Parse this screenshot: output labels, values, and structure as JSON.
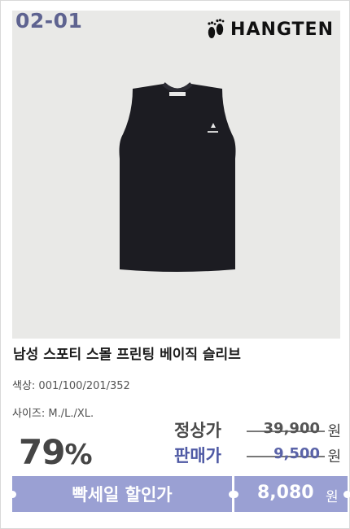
{
  "product": {
    "code": "02-01",
    "brand": "HANGTEN",
    "title": "남성 스포티 스몰 프린팅 베이직 슬리브",
    "colors_label": "색상",
    "colors_value": ": 001/100/201/352",
    "sizes_label": "사이즈",
    "sizes_value": ": M./L./XL.",
    "colors": {
      "accent": "#9aa0d3",
      "code_text": "#5e6390",
      "sale_label": "#4e59a4",
      "shirt": "#1c1c22"
    }
  },
  "pricing": {
    "discount": "79",
    "discount_symbol": "%",
    "regular_label": "정상가",
    "regular_price": "39,900",
    "sale_label": "판매가",
    "sale_price": "9,500",
    "currency": "원"
  },
  "promo": {
    "label": "빡세일 할인가",
    "final_price": "8,080",
    "currency": "원"
  },
  "icons": {
    "brand_logo": "footprint-icon",
    "product_image": "tshirt-image"
  }
}
